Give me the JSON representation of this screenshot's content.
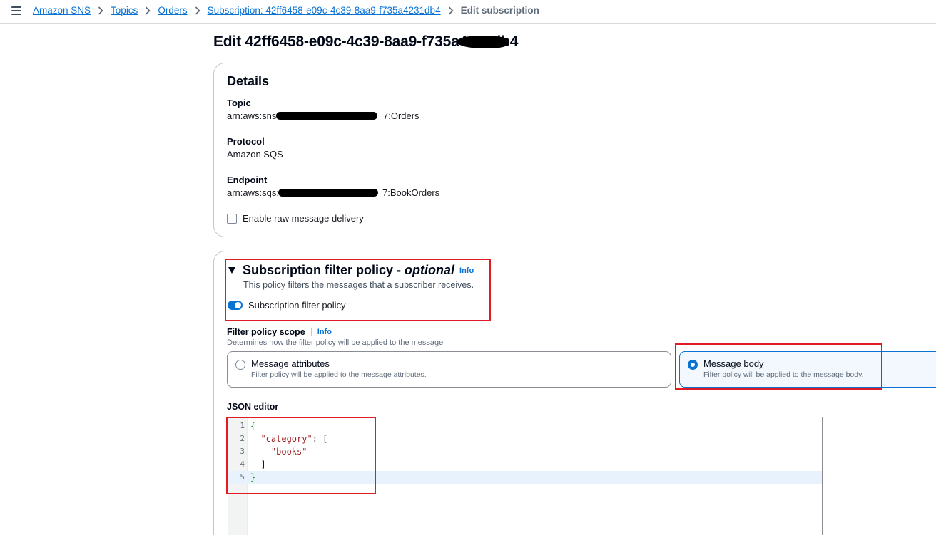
{
  "breadcrumb": {
    "items": [
      "Amazon SNS",
      "Topics",
      "Orders",
      "Subscription: 42ff6458-e09c-4c39-8aa9-f735a4231db4"
    ],
    "current": "Edit subscription"
  },
  "page": {
    "title": "Edit 42ff6458-e09c-4c39-8aa9-f735a4231db4"
  },
  "details": {
    "heading": "Details",
    "topic_label": "Topic",
    "topic_prefix": "arn:aws:sns:",
    "topic_suffix": "7:Orders",
    "protocol_label": "Protocol",
    "protocol_value": "Amazon SQS",
    "endpoint_label": "Endpoint",
    "endpoint_prefix": "arn:aws:sqs:",
    "endpoint_suffix": "7:BookOrders",
    "raw_delivery_label": "Enable raw message delivery",
    "raw_delivery_checked": false
  },
  "filter_policy": {
    "title": "Subscription filter policy - ",
    "title_optional": "optional",
    "info": "Info",
    "description": "This policy filters the messages that a subscriber receives.",
    "toggle_label": "Subscription filter policy",
    "toggle_on": true,
    "scope_label": "Filter policy scope",
    "scope_info": "Info",
    "scope_description": "Determines how the filter policy will be applied to the message",
    "options": [
      {
        "title": "Message attributes",
        "subtitle": "Filter policy will be applied to the message attributes.",
        "selected": false
      },
      {
        "title": "Message body",
        "subtitle": "Filter policy will be applied to the message body.",
        "selected": true
      }
    ],
    "json_label": "JSON editor",
    "json_line_numbers": [
      "1",
      "2",
      "3",
      "4",
      "5"
    ]
  },
  "colors": {
    "link": "#0972d3",
    "highlight": "#e01b24",
    "brace": "#1d9a3a",
    "string": "#9c1c1c"
  }
}
